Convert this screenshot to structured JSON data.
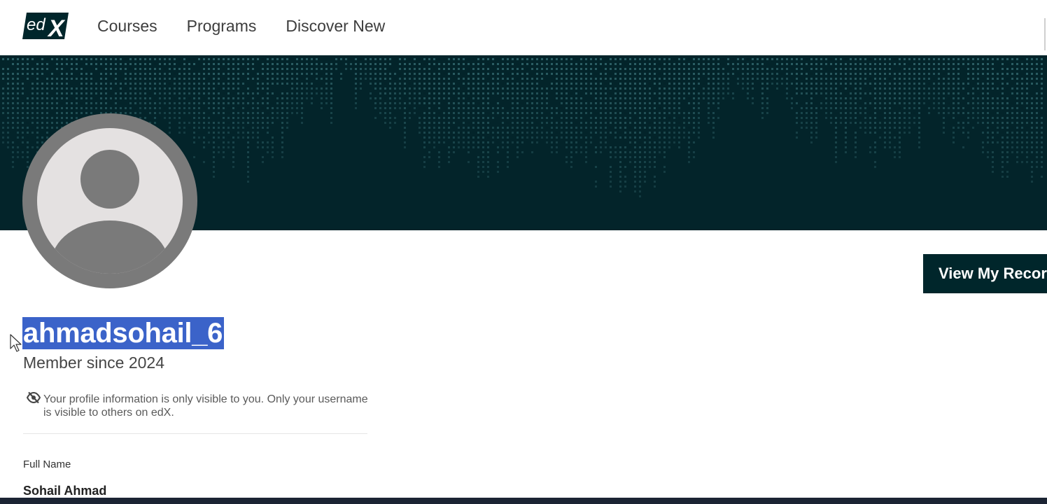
{
  "brand": {
    "logo_text": "edX",
    "logo_color": "#00262b"
  },
  "nav": {
    "items": [
      {
        "label": "Courses"
      },
      {
        "label": "Programs"
      },
      {
        "label": "Discover New"
      }
    ]
  },
  "profile": {
    "username": "ahmadsohail_6",
    "member_since": "Member since 2024",
    "visibility_note": "Your profile information is only visible to you. Only your username is visible to others on edX.",
    "view_records_label": "View My Records",
    "fields": [
      {
        "label": "Full Name",
        "value": "Sohail Ahmad"
      }
    ]
  },
  "colors": {
    "banner": "#03242a",
    "selection": "#3b63c9",
    "button": "#00262b"
  }
}
